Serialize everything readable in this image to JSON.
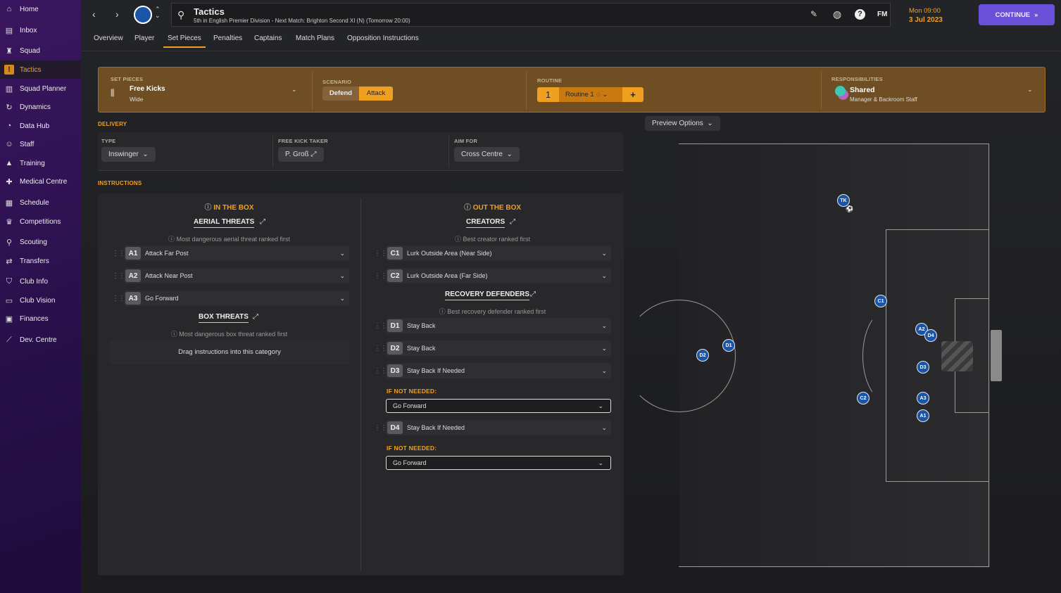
{
  "sidebar": {
    "items": [
      {
        "label": "Home",
        "icon": "home-icon"
      },
      {
        "label": "Inbox",
        "icon": "inbox-icon"
      },
      {
        "label": "Squad",
        "icon": "shirt-icon"
      },
      {
        "label": "Tactics",
        "icon": "tactics-icon",
        "active": true
      },
      {
        "label": "Squad Planner",
        "icon": "clipboard-icon"
      },
      {
        "label": "Dynamics",
        "icon": "dynamics-icon"
      },
      {
        "label": "Data Hub",
        "icon": "data-hub-icon"
      },
      {
        "label": "Staff",
        "icon": "staff-icon"
      },
      {
        "label": "Training",
        "icon": "training-icon"
      },
      {
        "label": "Medical Centre",
        "icon": "medical-icon"
      },
      {
        "label": "Schedule",
        "icon": "calendar-icon"
      },
      {
        "label": "Competitions",
        "icon": "trophy-icon"
      },
      {
        "label": "Scouting",
        "icon": "search-icon"
      },
      {
        "label": "Transfers",
        "icon": "transfers-icon"
      },
      {
        "label": "Club Info",
        "icon": "shield-icon"
      },
      {
        "label": "Club Vision",
        "icon": "vision-icon"
      },
      {
        "label": "Finances",
        "icon": "finances-icon"
      },
      {
        "label": "Dev. Centre",
        "icon": "dev-centre-icon"
      }
    ]
  },
  "header": {
    "title": "Tactics",
    "subtitle": "5th in English Premier Division - Next Match: Brighton Second XI (N) (Tomorrow 20:00)",
    "fm": "FM",
    "date_time": "Mon 09:00",
    "date": "3 Jul 2023",
    "continue": "CONTINUE"
  },
  "tabs": [
    "Overview",
    "Player",
    "Set Pieces",
    "Penalties",
    "Captains",
    "Match Plans",
    "Opposition Instructions"
  ],
  "active_tab": "Set Pieces",
  "banner": {
    "set_pieces_label": "SET PIECES",
    "set_piece": "Free Kicks",
    "set_piece_sub": "Wide",
    "scenario_label": "SCENARIO",
    "defend": "Defend",
    "attack": "Attack",
    "routine_label": "ROUTINE",
    "routine_num": "1",
    "routine_name": "Routine 1",
    "add": "+",
    "resp_label": "RESPONSIBILITIES",
    "resp": "Shared",
    "resp_sub": "Manager & Backroom Staff"
  },
  "colors": {
    "accent": "#f0a020",
    "banner": "#6e4e22",
    "continue": "#6a4fd8",
    "player": "#1a55a8"
  },
  "delivery": {
    "label": "DELIVERY",
    "type_label": "TYPE",
    "type": "Inswinger",
    "taker_label": "FREE KICK TAKER",
    "taker": "P. Groß",
    "aim_label": "AIM FOR",
    "aim": "Cross Centre"
  },
  "preview": "Preview Options",
  "instructions": {
    "label": "INSTRUCTIONS",
    "in_box": {
      "title": "IN THE BOX",
      "aerial": "AERIAL THREATS",
      "aerial_note": "Most dangerous aerial threat ranked first",
      "aerial_rows": [
        {
          "code": "A1",
          "text": "Attack Far Post"
        },
        {
          "code": "A2",
          "text": "Attack Near Post"
        },
        {
          "code": "A3",
          "text": "Go Forward"
        }
      ],
      "box": "BOX THREATS",
      "box_note": "Most dangerous box threat ranked first",
      "drag": "Drag instructions into this category"
    },
    "out_box": {
      "title": "OUT THE BOX",
      "creators": "CREATORS",
      "creators_note": "Best creator ranked first",
      "creator_rows": [
        {
          "code": "C1",
          "text": "Lurk Outside Area (Near Side)"
        },
        {
          "code": "C2",
          "text": "Lurk Outside Area (Far Side)"
        }
      ],
      "recovery": "RECOVERY DEFENDERS",
      "recovery_note": "Best recovery defender ranked first",
      "recovery_rows": [
        {
          "code": "D1",
          "text": "Stay Back"
        },
        {
          "code": "D2",
          "text": "Stay Back"
        },
        {
          "code": "D3",
          "text": "Stay Back If Needed"
        },
        {
          "code": "D4",
          "text": "Stay Back If Needed"
        }
      ],
      "if_not": "IF NOT NEEDED:",
      "d3_alt": "Go Forward",
      "d4_alt": "Go Forward"
    }
  },
  "pitch": {
    "players": [
      "TK",
      "C1",
      "A2",
      "D4",
      "D3",
      "A3",
      "A1",
      "C2",
      "D1",
      "D2"
    ]
  }
}
